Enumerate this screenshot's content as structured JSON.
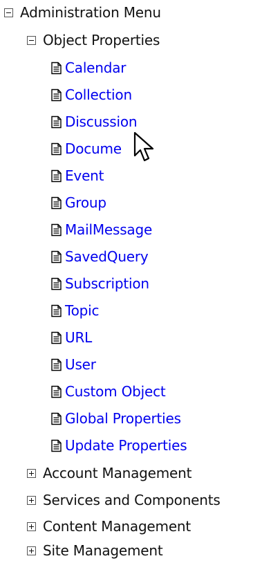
{
  "tree": {
    "root": {
      "label": "Administration Menu",
      "expanded": true
    },
    "object_properties": {
      "label": "Object Properties",
      "expanded": true,
      "items": [
        {
          "label": "Calendar",
          "icon": "document-icon"
        },
        {
          "label": "Collection",
          "icon": "document-icon"
        },
        {
          "label": "Discussion",
          "icon": "document-icon"
        },
        {
          "label": "Docume",
          "icon": "document-icon"
        },
        {
          "label": "Event",
          "icon": "document-icon"
        },
        {
          "label": "Group",
          "icon": "document-icon"
        },
        {
          "label": "MailMessage",
          "icon": "document-icon"
        },
        {
          "label": "SavedQuery",
          "icon": "document-icon"
        },
        {
          "label": "Subscription",
          "icon": "document-icon"
        },
        {
          "label": "Topic",
          "icon": "document-icon"
        },
        {
          "label": "URL",
          "icon": "document-icon"
        },
        {
          "label": "User",
          "icon": "document-icon"
        },
        {
          "label": "Custom Object",
          "icon": "document-icon"
        },
        {
          "label": "Global Properties",
          "icon": "document-icon"
        },
        {
          "label": "Update Properties",
          "icon": "document-icon"
        }
      ]
    },
    "collapsed_sections": [
      {
        "label": "Account Management",
        "expanded": false
      },
      {
        "label": "Services and Components",
        "expanded": false
      },
      {
        "label": "Content Management",
        "expanded": false
      },
      {
        "label": "Site Management",
        "expanded": false
      }
    ]
  },
  "colors": {
    "link": "#0000ee",
    "text": "#111111",
    "background": "#ffffff"
  },
  "cursor": {
    "icon": "arrow-pointer-icon"
  }
}
